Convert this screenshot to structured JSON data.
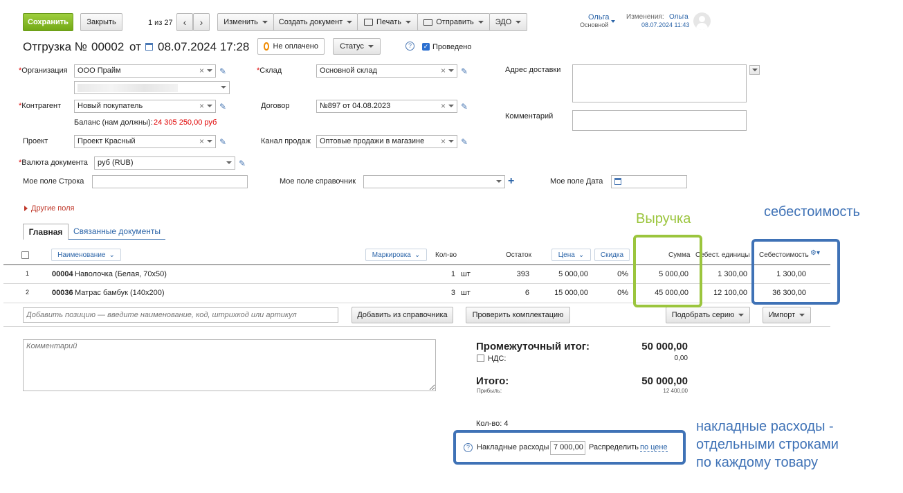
{
  "toolbar": {
    "save": "Сохранить",
    "close": "Закрыть",
    "pager": "1 из 27",
    "change": "Изменить",
    "create_doc": "Создать документ",
    "print": "Печать",
    "send": "Отправить",
    "edo": "ЭДО"
  },
  "user": {
    "name": "Ольга",
    "role": "Основной",
    "changes_label": "Изменения:",
    "changes_user": "Ольга",
    "changes_date": "08.07.2024 11:43"
  },
  "header": {
    "doc_type": "Отгрузка №",
    "number": "00002",
    "from": "от",
    "date": "08.07.2024 17:28",
    "payment_status": "Не оплачено",
    "status_btn": "Статус",
    "posted_label": "Проведено",
    "help": "?"
  },
  "form": {
    "org_label": "Организация",
    "org_value": "ООО Прайм",
    "warehouse_label": "Склад",
    "warehouse_value": "Основной склад",
    "delivery_label": "Адрес доставки",
    "counterparty_label": "Контрагент",
    "counterparty_value": "Новый покупатель",
    "contract_label": "Договор",
    "contract_value": "№897 от 04.08.2023",
    "comment_label": "Комментарий",
    "balance_label": "Баланс (нам должны):",
    "balance_value": "24 305 250,00 руб",
    "project_label": "Проект",
    "project_value": "Проект Красный",
    "channel_label": "Канал продаж",
    "channel_value": "Оптовые продажи в магазине",
    "currency_label": "Валюта документа",
    "currency_value": "руб (RUB)",
    "my_string_label": "Мое поле Строка",
    "my_ref_label": "Мое поле справочник",
    "my_date_label": "Мое поле Дата",
    "other_fields": "Другие поля"
  },
  "tabs": {
    "main": "Главная",
    "linked": "Связанные документы"
  },
  "table": {
    "headers": {
      "name": "Наименование",
      "marking": "Маркировка",
      "qty": "Кол-во",
      "stock": "Остаток",
      "price": "Цена",
      "discount": "Скидка",
      "sum": "Сумма",
      "unit_cost": "Себест. единицы",
      "cost": "Себестоимость"
    },
    "rows": [
      {
        "n": "1",
        "code": "00004",
        "name": "Наволочка (Белая, 70x50)",
        "qty": "1",
        "unit": "шт",
        "stock": "393",
        "price": "5 000,00",
        "discount": "0%",
        "sum": "5 000,00",
        "unit_cost": "1 300,00",
        "cost": "1 300,00"
      },
      {
        "n": "2",
        "code": "00036",
        "name": "Матрас бамбук (140x200)",
        "qty": "3",
        "unit": "шт",
        "stock": "6",
        "price": "15 000,00",
        "discount": "0%",
        "sum": "45 000,00",
        "unit_cost": "12 100,00",
        "cost": "36 300,00"
      }
    ],
    "add_placeholder": "Добавить позицию — введите наименование, код, штрихкод или артикул",
    "add_from_catalog": "Добавить из справочника",
    "check_kit": "Проверить комплектацию",
    "pick_series": "Подобрать серию",
    "import": "Импорт"
  },
  "summary": {
    "comment_placeholder": "Комментарий",
    "subtotal_label": "Промежуточный итог:",
    "subtotal_value": "50 000,00",
    "vat_label": "НДС:",
    "vat_value": "0,00",
    "total_label": "Итого:",
    "total_value": "50 000,00",
    "profit_label": "Прибыль:",
    "profit_value": "12 400,00",
    "qty_label": "Кол-во: 4",
    "overhead_label": "Накладные расходы",
    "overhead_value": "7 000,00",
    "distribute_label": "Распределить",
    "distribute_link": "по цене"
  },
  "annotations": {
    "revenue": "Выручка",
    "cost": "себестоимость",
    "overhead_line1": "накладные расходы -",
    "overhead_line2": "отдельными строками",
    "overhead_line3": "по каждому товару"
  },
  "colors": {
    "green_annotation": "#9bc53d",
    "blue_annotation": "#3f72b6",
    "balance_red": "#e00000",
    "link_blue": "#2b64a8"
  }
}
